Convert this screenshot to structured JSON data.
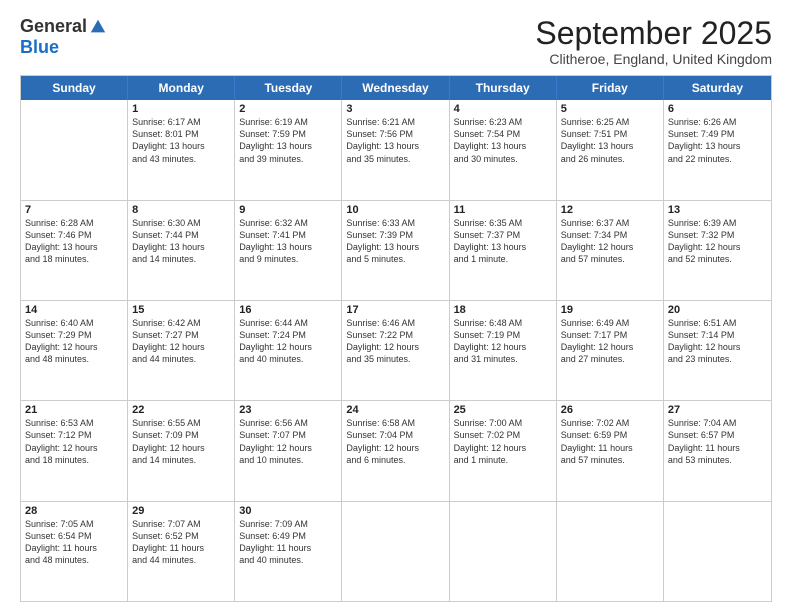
{
  "logo": {
    "general": "General",
    "blue": "Blue"
  },
  "title": "September 2025",
  "location": "Clitheroe, England, United Kingdom",
  "dayHeaders": [
    "Sunday",
    "Monday",
    "Tuesday",
    "Wednesday",
    "Thursday",
    "Friday",
    "Saturday"
  ],
  "weeks": [
    [
      {
        "day": "",
        "info": ""
      },
      {
        "day": "1",
        "info": "Sunrise: 6:17 AM\nSunset: 8:01 PM\nDaylight: 13 hours\nand 43 minutes."
      },
      {
        "day": "2",
        "info": "Sunrise: 6:19 AM\nSunset: 7:59 PM\nDaylight: 13 hours\nand 39 minutes."
      },
      {
        "day": "3",
        "info": "Sunrise: 6:21 AM\nSunset: 7:56 PM\nDaylight: 13 hours\nand 35 minutes."
      },
      {
        "day": "4",
        "info": "Sunrise: 6:23 AM\nSunset: 7:54 PM\nDaylight: 13 hours\nand 30 minutes."
      },
      {
        "day": "5",
        "info": "Sunrise: 6:25 AM\nSunset: 7:51 PM\nDaylight: 13 hours\nand 26 minutes."
      },
      {
        "day": "6",
        "info": "Sunrise: 6:26 AM\nSunset: 7:49 PM\nDaylight: 13 hours\nand 22 minutes."
      }
    ],
    [
      {
        "day": "7",
        "info": "Sunrise: 6:28 AM\nSunset: 7:46 PM\nDaylight: 13 hours\nand 18 minutes."
      },
      {
        "day": "8",
        "info": "Sunrise: 6:30 AM\nSunset: 7:44 PM\nDaylight: 13 hours\nand 14 minutes."
      },
      {
        "day": "9",
        "info": "Sunrise: 6:32 AM\nSunset: 7:41 PM\nDaylight: 13 hours\nand 9 minutes."
      },
      {
        "day": "10",
        "info": "Sunrise: 6:33 AM\nSunset: 7:39 PM\nDaylight: 13 hours\nand 5 minutes."
      },
      {
        "day": "11",
        "info": "Sunrise: 6:35 AM\nSunset: 7:37 PM\nDaylight: 13 hours\nand 1 minute."
      },
      {
        "day": "12",
        "info": "Sunrise: 6:37 AM\nSunset: 7:34 PM\nDaylight: 12 hours\nand 57 minutes."
      },
      {
        "day": "13",
        "info": "Sunrise: 6:39 AM\nSunset: 7:32 PM\nDaylight: 12 hours\nand 52 minutes."
      }
    ],
    [
      {
        "day": "14",
        "info": "Sunrise: 6:40 AM\nSunset: 7:29 PM\nDaylight: 12 hours\nand 48 minutes."
      },
      {
        "day": "15",
        "info": "Sunrise: 6:42 AM\nSunset: 7:27 PM\nDaylight: 12 hours\nand 44 minutes."
      },
      {
        "day": "16",
        "info": "Sunrise: 6:44 AM\nSunset: 7:24 PM\nDaylight: 12 hours\nand 40 minutes."
      },
      {
        "day": "17",
        "info": "Sunrise: 6:46 AM\nSunset: 7:22 PM\nDaylight: 12 hours\nand 35 minutes."
      },
      {
        "day": "18",
        "info": "Sunrise: 6:48 AM\nSunset: 7:19 PM\nDaylight: 12 hours\nand 31 minutes."
      },
      {
        "day": "19",
        "info": "Sunrise: 6:49 AM\nSunset: 7:17 PM\nDaylight: 12 hours\nand 27 minutes."
      },
      {
        "day": "20",
        "info": "Sunrise: 6:51 AM\nSunset: 7:14 PM\nDaylight: 12 hours\nand 23 minutes."
      }
    ],
    [
      {
        "day": "21",
        "info": "Sunrise: 6:53 AM\nSunset: 7:12 PM\nDaylight: 12 hours\nand 18 minutes."
      },
      {
        "day": "22",
        "info": "Sunrise: 6:55 AM\nSunset: 7:09 PM\nDaylight: 12 hours\nand 14 minutes."
      },
      {
        "day": "23",
        "info": "Sunrise: 6:56 AM\nSunset: 7:07 PM\nDaylight: 12 hours\nand 10 minutes."
      },
      {
        "day": "24",
        "info": "Sunrise: 6:58 AM\nSunset: 7:04 PM\nDaylight: 12 hours\nand 6 minutes."
      },
      {
        "day": "25",
        "info": "Sunrise: 7:00 AM\nSunset: 7:02 PM\nDaylight: 12 hours\nand 1 minute."
      },
      {
        "day": "26",
        "info": "Sunrise: 7:02 AM\nSunset: 6:59 PM\nDaylight: 11 hours\nand 57 minutes."
      },
      {
        "day": "27",
        "info": "Sunrise: 7:04 AM\nSunset: 6:57 PM\nDaylight: 11 hours\nand 53 minutes."
      }
    ],
    [
      {
        "day": "28",
        "info": "Sunrise: 7:05 AM\nSunset: 6:54 PM\nDaylight: 11 hours\nand 48 minutes."
      },
      {
        "day": "29",
        "info": "Sunrise: 7:07 AM\nSunset: 6:52 PM\nDaylight: 11 hours\nand 44 minutes."
      },
      {
        "day": "30",
        "info": "Sunrise: 7:09 AM\nSunset: 6:49 PM\nDaylight: 11 hours\nand 40 minutes."
      },
      {
        "day": "",
        "info": ""
      },
      {
        "day": "",
        "info": ""
      },
      {
        "day": "",
        "info": ""
      },
      {
        "day": "",
        "info": ""
      }
    ]
  ]
}
